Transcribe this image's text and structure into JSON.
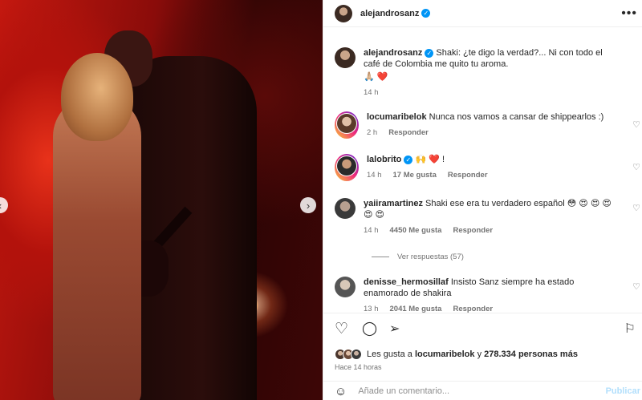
{
  "post": {
    "username": "alejandrosanz",
    "more_icon": "•••"
  },
  "caption": {
    "username": "alejandrosanz",
    "text": "Shaki: ¿te digo la verdad?... Ni con todo el café de Colombia me quito tu aroma.",
    "emojis": "🙏🏼 ❤️",
    "time": "14 h"
  },
  "comments": [
    {
      "username": "locumaribelok",
      "text": "Nunca nos vamos a cansar de shippearlos :)",
      "time": "2 h",
      "likes": "",
      "reply": "Responder"
    },
    {
      "username": "lalobrito",
      "text": "🙌 ❤️ !",
      "time": "14 h",
      "likes": "17 Me gusta",
      "reply": "Responder"
    },
    {
      "username": "yaiiramartinez",
      "text": "Shaki ese era tu verdadero español 😳 😍 😍 😍 😍 😍",
      "time": "14 h",
      "likes": "4450 Me gusta",
      "reply": "Responder"
    },
    {
      "username": "denisse_hermosillaf",
      "text": "Insisto Sanz siempre ha estado enamorado de shakira",
      "time": "13 h",
      "likes": "2041 Me gusta",
      "reply": "Responder"
    }
  ],
  "view_replies": "Ver respuestas (57)",
  "likes_line": {
    "prefix": "Les gusta a",
    "user": "locumaribelok",
    "connector": "y",
    "count": "278.334 personas más"
  },
  "posted_ago": "Hace 14 horas",
  "add_comment": {
    "placeholder": "Añade un comentario...",
    "publish": "Publicar"
  },
  "icons": {
    "like": "heart-outline-icon",
    "comment": "comment-icon",
    "share": "share-icon",
    "save": "bookmark-icon",
    "emoji": "smiley-icon"
  },
  "colors": {
    "link_blue": "#0095f6",
    "publish_disabled": "#b2dffc",
    "heart_red": "#ed4956"
  }
}
